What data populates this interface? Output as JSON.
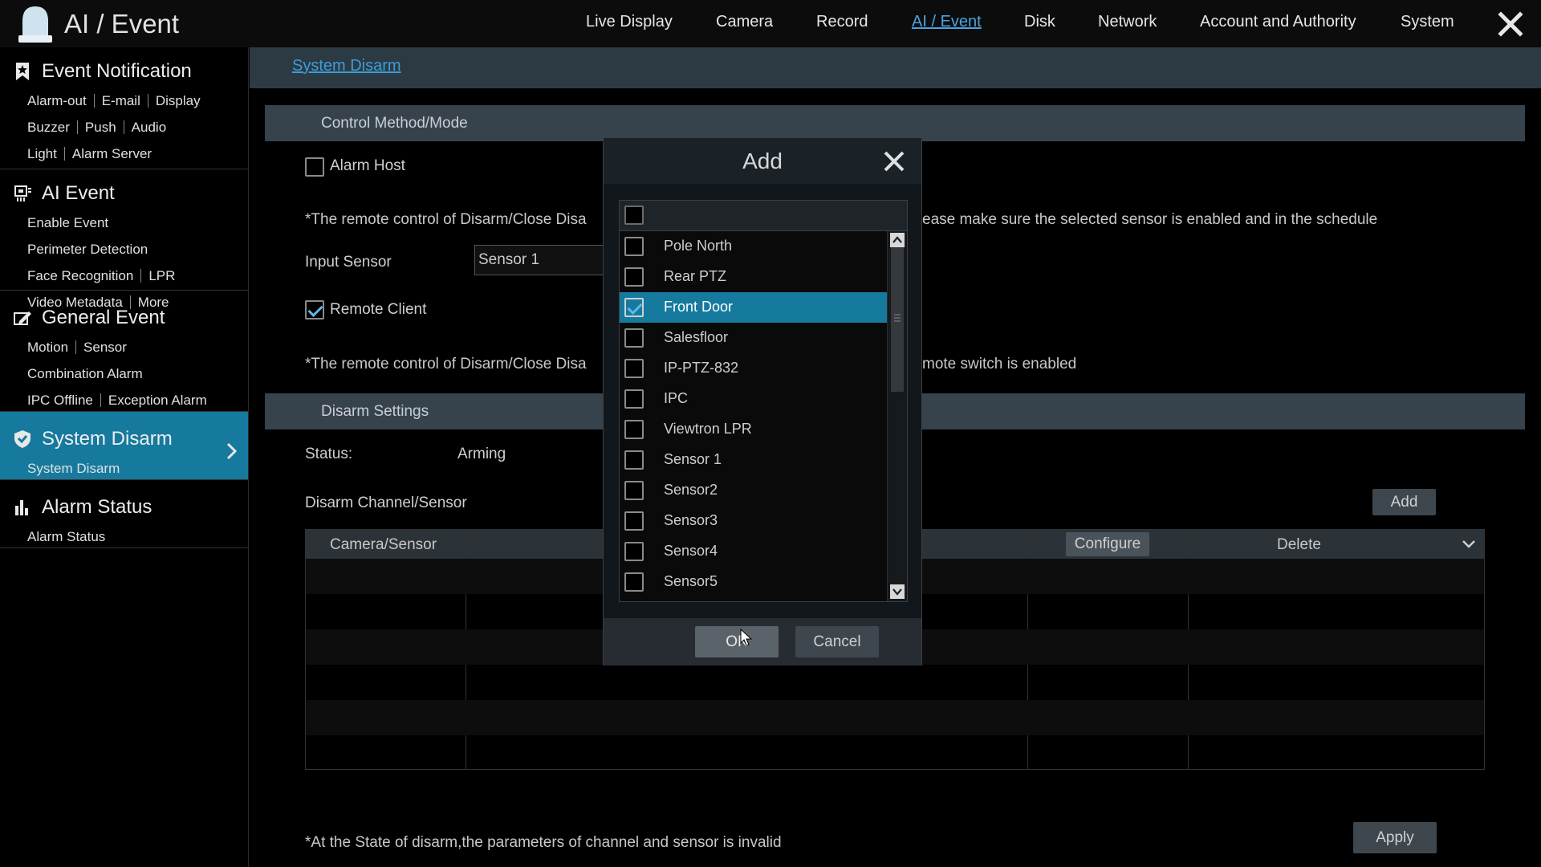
{
  "app": {
    "title": "AI / Event"
  },
  "nav": {
    "items": [
      {
        "label": "Live Display"
      },
      {
        "label": "Camera"
      },
      {
        "label": "Record"
      },
      {
        "label": "AI / Event",
        "active": true
      },
      {
        "label": "Disk"
      },
      {
        "label": "Network"
      },
      {
        "label": "Account and Authority"
      },
      {
        "label": "System"
      }
    ]
  },
  "sidebar": {
    "event_notification": {
      "title": "Event Notification",
      "links": [
        "Alarm-out",
        "E-mail",
        "Display",
        "Buzzer",
        "Push",
        "Audio",
        "Light",
        "Alarm Server"
      ]
    },
    "ai_event": {
      "title": "AI Event",
      "links": [
        "Enable Event",
        "Perimeter Detection",
        "Face Recognition",
        "LPR",
        "Video Metadata",
        "More"
      ]
    },
    "general_event": {
      "title": "General Event",
      "links": [
        "Motion",
        "Sensor",
        "Combination Alarm",
        "IPC Offline",
        "Exception Alarm"
      ]
    },
    "system_disarm": {
      "title": "System Disarm",
      "links": [
        "System Disarm"
      ]
    },
    "alarm_status": {
      "title": "Alarm Status",
      "links": [
        "Alarm Status"
      ]
    }
  },
  "content": {
    "breadcrumb": "System Disarm",
    "control_section": "Control Method/Mode",
    "alarm_host_label": "Alarm Host",
    "note_1a": "*The remote control of Disarm/Close Disa",
    "note_1b": "ease make sure the selected sensor is enabled and in the schedule",
    "input_sensor_label": "Input Sensor",
    "input_sensor_value": "Sensor 1",
    "remote_client_label": "Remote Client",
    "note_2a": "*The remote control of Disarm/Close Disa",
    "note_2b": "mote switch is enabled",
    "disarm_section": "Disarm Settings",
    "status_label": "Status:",
    "status_value": "Arming",
    "disarm_channel_label": "Disarm Channel/Sensor",
    "add_button": "Add",
    "table": {
      "col_camera": "Camera/Sensor",
      "col_configure": "Configure",
      "col_delete": "Delete"
    },
    "footer_note": "*At the State of disarm,the parameters of channel and sensor is invalid",
    "apply_button": "Apply"
  },
  "modal": {
    "title": "Add",
    "items": [
      {
        "label": "Pole North",
        "checked": false
      },
      {
        "label": "Rear PTZ",
        "checked": false
      },
      {
        "label": "Front Door",
        "checked": true
      },
      {
        "label": "Salesfloor",
        "checked": false
      },
      {
        "label": "IP-PTZ-832",
        "checked": false
      },
      {
        "label": "IPC",
        "checked": false
      },
      {
        "label": "Viewtron LPR",
        "checked": false
      },
      {
        "label": "Sensor 1",
        "checked": false
      },
      {
        "label": "Sensor2",
        "checked": false
      },
      {
        "label": "Sensor3",
        "checked": false
      },
      {
        "label": "Sensor4",
        "checked": false
      },
      {
        "label": "Sensor5",
        "checked": false
      }
    ],
    "ok_button": "OK",
    "cancel_button": "Cancel"
  },
  "colors": {
    "accent": "#167a9e",
    "link": "#3b9ed8"
  }
}
